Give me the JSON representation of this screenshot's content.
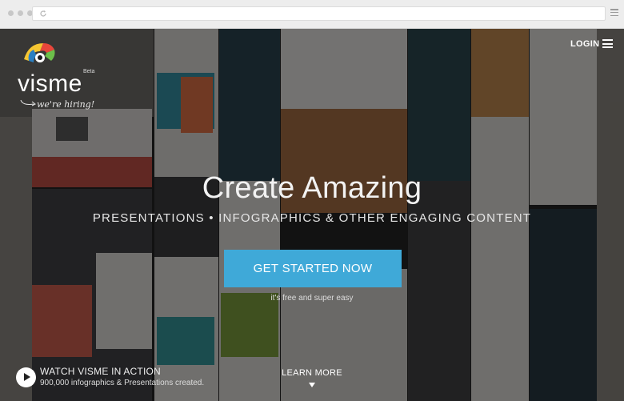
{
  "header": {
    "logo_text": "visme",
    "beta_label": "Beta",
    "hiring_text": "we're hiring!",
    "login_label": "LOGIN",
    "menu_icon": "hamburger-icon"
  },
  "hero": {
    "title": "Create Amazing",
    "subtitle": "PRESENTATIONS • INFOGRAPHICS & OTHER ENGAGING CONTENT",
    "cta_label": "GET STARTED NOW",
    "cta_note": "it's free and super easy"
  },
  "footer": {
    "watch_title": "WATCH VISME IN ACTION",
    "watch_stats": "900,000 infographics & Presentations created.",
    "learn_more": "LEARN MORE"
  },
  "colors": {
    "cta": "#3fa9d8",
    "logo_red": "#e8463b",
    "logo_yellow": "#f5c531",
    "logo_green": "#6cbf4a",
    "logo_blue": "#2a7fc1"
  }
}
